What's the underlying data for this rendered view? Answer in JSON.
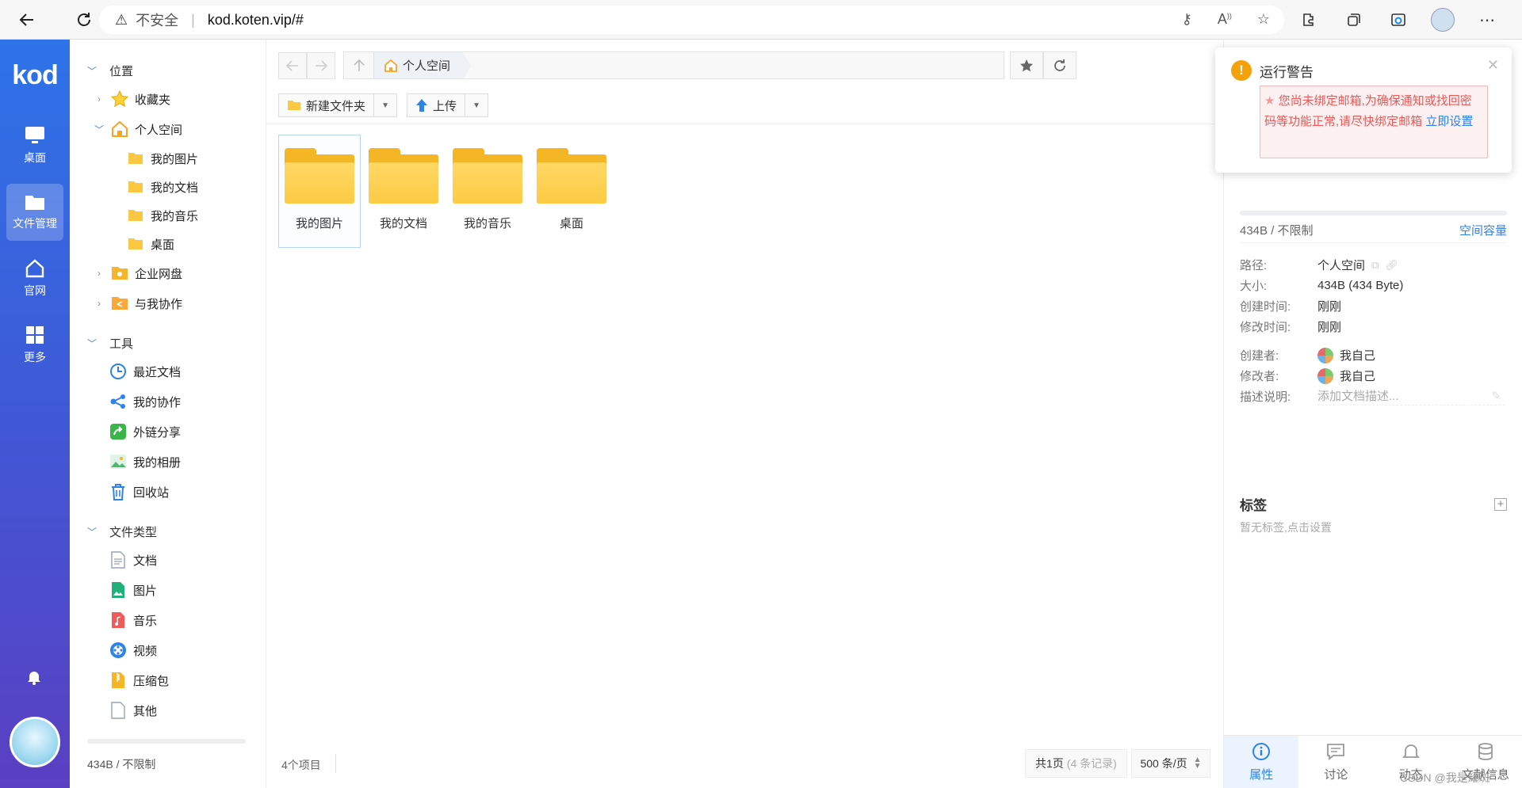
{
  "browser": {
    "security_label": "不安全",
    "url": "kod.koten.vip/#"
  },
  "app_nav": {
    "logo": "kod",
    "items": [
      {
        "label": "桌面",
        "icon": "monitor-icon"
      },
      {
        "label": "文件管理",
        "icon": "folder-icon",
        "active": true
      },
      {
        "label": "官网",
        "icon": "home-icon"
      },
      {
        "label": "更多",
        "icon": "grid-icon"
      }
    ]
  },
  "tree": {
    "location_title": "位置",
    "favorites": "收藏夹",
    "personal_space": "个人空间",
    "personal_children": [
      "我的图片",
      "我的文档",
      "我的音乐",
      "桌面"
    ],
    "enterprise_disk": "企业网盘",
    "shared_with_me": "与我协作",
    "tools_title": "工具",
    "tools": [
      {
        "label": "最近文档",
        "icon": "clock-icon",
        "color": "#2e82e8"
      },
      {
        "label": "我的协作",
        "icon": "share-nodes-icon",
        "color": "#2e82e8"
      },
      {
        "label": "外链分享",
        "icon": "external-share-icon",
        "color": "#3ab54a"
      },
      {
        "label": "我的相册",
        "icon": "photo-album-icon",
        "color": "#5bbf7a"
      },
      {
        "label": "回收站",
        "icon": "trash-icon",
        "color": "#2e82e8"
      }
    ],
    "filetypes_title": "文件类型",
    "filetypes": [
      {
        "label": "文档",
        "icon": "document-icon",
        "color": "#9aa3b0"
      },
      {
        "label": "图片",
        "icon": "image-file-icon",
        "color": "#21b07a"
      },
      {
        "label": "音乐",
        "icon": "music-file-icon",
        "color": "#f05a5a"
      },
      {
        "label": "视频",
        "icon": "video-icon",
        "color": "#2e82e8"
      },
      {
        "label": "压缩包",
        "icon": "zip-icon",
        "color": "#f5b626"
      },
      {
        "label": "其他",
        "icon": "other-file-icon",
        "color": "#9aa3b0"
      }
    ],
    "footer_capacity": "434B / 不限制"
  },
  "main": {
    "breadcrumb": "个人空间",
    "toolbar": {
      "new_folder": "新建文件夹",
      "upload": "上传"
    },
    "files": [
      "我的图片",
      "我的文档",
      "我的音乐",
      "桌面"
    ],
    "item_count": "4个项目",
    "pager": {
      "pages": "共1页",
      "records": "(4 条记录)",
      "per_page": "500 条/页"
    }
  },
  "info": {
    "capacity_used": "434B / 不限制",
    "capacity_link": "空间容量",
    "props": {
      "path_k": "路径:",
      "path_v": "个人空间",
      "size_k": "大小:",
      "size_v": "434B (434 Byte)",
      "created_k": "创建时间:",
      "created_v": "刚刚",
      "modified_k": "修改时间:",
      "modified_v": "刚刚",
      "creator_k": "创建者:",
      "creator_v": "我自己",
      "modifier_k": "修改者:",
      "modifier_v": "我自己",
      "desc_k": "描述说明:",
      "desc_placeholder": "添加文档描述..."
    },
    "tags_title": "标签",
    "tags_empty": "暂无标签,点击设置",
    "tabs": [
      {
        "label": "属性",
        "icon": "info-icon",
        "active": true
      },
      {
        "label": "讨论",
        "icon": "comment-icon"
      },
      {
        "label": "动态",
        "icon": "bell-icon"
      },
      {
        "label": "文献信息",
        "icon": "database-icon"
      }
    ],
    "watermark": "CSDN @我是耀斑"
  },
  "alert": {
    "title": "运行警告",
    "message": "您尚未绑定邮箱,为确保通知或找回密码等功能正常,请尽快绑定邮箱",
    "link": "立即设置"
  }
}
